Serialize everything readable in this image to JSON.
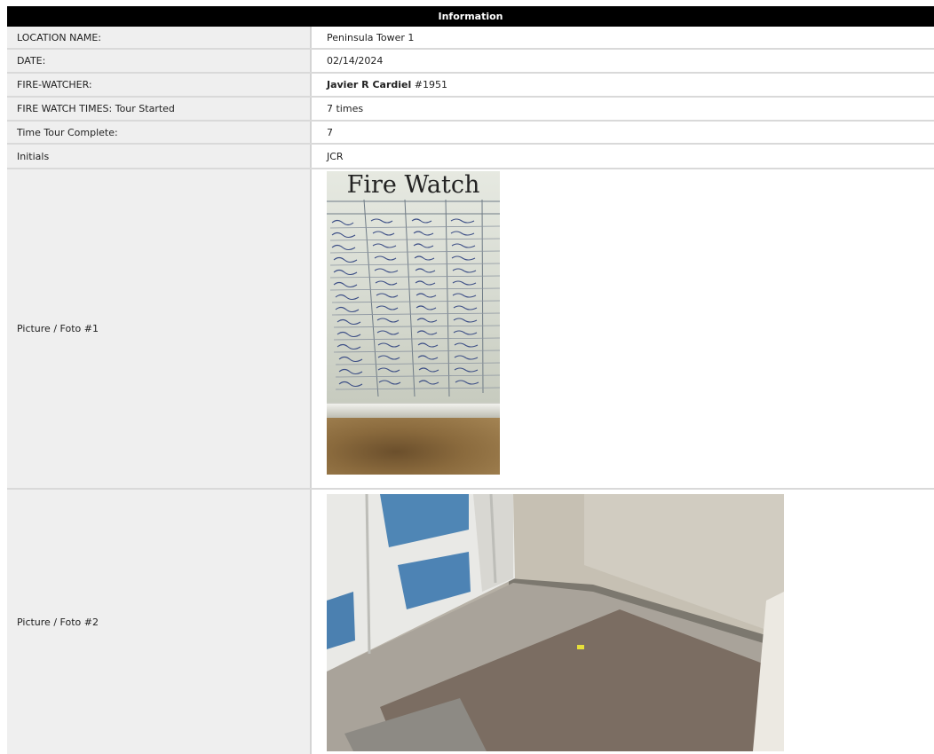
{
  "header": {
    "title": "Information"
  },
  "rows": [
    {
      "label": "LOCATION NAME:",
      "value": "Peninsula Tower 1"
    },
    {
      "label": "DATE:",
      "value": "02/14/2024"
    },
    {
      "label": "FIRE-WATCHER:",
      "value_bold": "Javier R Cardiel",
      "value_rest": " #1951"
    },
    {
      "label": "FIRE WATCH TIMES: Tour Started",
      "value": "7 times"
    },
    {
      "label": "Time Tour Complete:",
      "value": "7"
    },
    {
      "label": "Initials",
      "value": "JCR"
    }
  ],
  "pictures": [
    {
      "label": "Picture / Foto #1",
      "caption": "Fire Watch"
    },
    {
      "label": "Picture / Foto #2"
    }
  ]
}
